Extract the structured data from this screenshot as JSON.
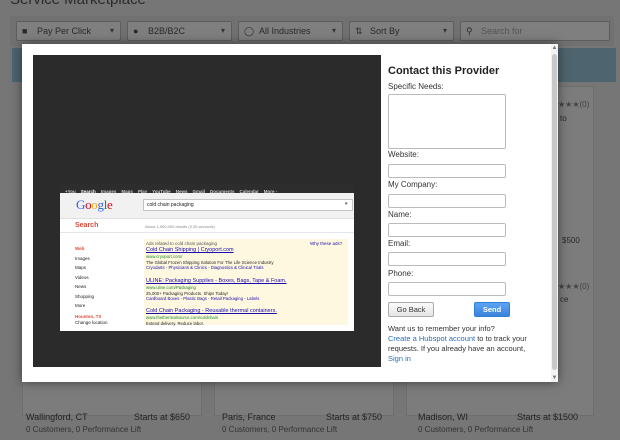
{
  "background": {
    "title": "Service Marketplace",
    "filters": [
      {
        "label": "Pay Per Click",
        "icon": "megaphone-icon"
      },
      {
        "label": "B2B/B2C",
        "icon": "people-icon"
      },
      {
        "label": "All Industries",
        "icon": "globe-icon"
      },
      {
        "label": "Sort By",
        "icon": "sort-icon"
      }
    ],
    "search_placeholder": "Search for",
    "cards": [
      {
        "location": "Wallingford, CT",
        "price": "Starts at $650",
        "meta": "0 Customers, 0 Performance Lift"
      },
      {
        "location": "Paris, France",
        "price": "Starts at $750",
        "meta": "0 Customers, 0 Performance Lift"
      },
      {
        "location": "Madison, WI",
        "price": "Starts at $1500",
        "meta": "0 Customers, 0 Performance Lift"
      }
    ],
    "side_fragments": {
      "rating1": "(0)",
      "price_right": "$500",
      "rating2": "(0)",
      "frag_a": "to",
      "frag_b": "ce"
    }
  },
  "google": {
    "topbar": [
      "+You",
      "Search",
      "Images",
      "Maps",
      "Play",
      "YouTube",
      "News",
      "Gmail",
      "Documents",
      "Calendar",
      "More -"
    ],
    "logo": [
      {
        "ch": "G",
        "color": "#3369e8"
      },
      {
        "ch": "o",
        "color": "#d50f25"
      },
      {
        "ch": "o",
        "color": "#eeb211"
      },
      {
        "ch": "g",
        "color": "#3369e8"
      },
      {
        "ch": "l",
        "color": "#009925"
      },
      {
        "ch": "e",
        "color": "#d50f25"
      }
    ],
    "query": "cold chain packaging",
    "search_label": "Search",
    "stats": "About 1,590,000 results (0.35 seconds)",
    "left_nav": [
      "Web",
      "Images",
      "Maps",
      "Videos",
      "News",
      "Shopping",
      "More"
    ],
    "location": "Houston, TX",
    "change_location": "Change location",
    "ads_line": "Ads related to cold chain packaging",
    "why_ads": "Why these ads?",
    "ads": [
      {
        "title": "Cold Chain Shipping | Cryoport.com",
        "url": "www.cryoport.com/",
        "desc1": "The Global Frozen Shipping Solution For The Life Science Industry",
        "desc2": "Cryodarts - Physicians & Clinics - Diagnostics & Clinical Trials"
      },
      {
        "title": "ULINE: Packaging Supplies - Boxes, Bags, Tape & Foam.",
        "url": "www.uline.com/Packaging",
        "desc1": "25,000+ Packaging Products. Ships Today!",
        "desc2": "Cardboard Boxes - Plastic Bags - Retail Packaging - Labels"
      },
      {
        "title": "Cold Chain Packaging - Reusable thermal containers.",
        "url": "www.thethermalsource.com/coldchain",
        "desc1": "Extend delivery. Reduce labor.",
        "desc2": ""
      }
    ]
  },
  "form": {
    "title": "Contact this Provider",
    "specific_needs": "Specific Needs:",
    "website": "Website:",
    "company": "My Company:",
    "name": "Name:",
    "email": "Email:",
    "phone": "Phone:",
    "back_button": "Go Back",
    "send_button": "Send",
    "note_prefix": "Want us to remember your info?",
    "note_link": "Create a Hubspot account",
    "note_suffix": " to to track your requests. If you already have an account,",
    "sign_in": "Sign in"
  }
}
